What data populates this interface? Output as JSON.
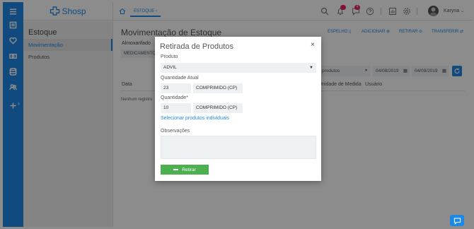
{
  "brand": {
    "name": "Shosp"
  },
  "sidebar": {
    "title": "Estoque",
    "items": [
      {
        "label": "Movimentação",
        "active": true
      },
      {
        "label": "Produtos",
        "active": false
      }
    ]
  },
  "rail": {
    "icons": [
      "menu-icon",
      "list-icon",
      "heart-icon",
      "money-icon",
      "database-icon",
      "people-icon",
      "plus-icon"
    ],
    "expand_glyph": "›"
  },
  "topbar": {
    "breadcrumb": "ESTOQUE",
    "notification_badge": "",
    "messages_badge": "4",
    "user_name": "Karyna",
    "user_caret": "⌄"
  },
  "page": {
    "title": "Movimentação de Estoque",
    "actions": {
      "espelho": "ESPELHO",
      "adicionar": "ADICIONAR",
      "retirar": "RETIRAR",
      "transferir": "TRANSFERIR"
    },
    "almoxarifado_label": "Almoxarifado",
    "almoxarifado_chip": "MEDICAMENTOS",
    "filter_select": "produtos",
    "date_from": "04/08/2019",
    "date_to": "04/09/2019",
    "columns": [
      "Data",
      "Unidade de Medida",
      "Usuário"
    ],
    "empty_text": "Nenhum registro"
  },
  "modal": {
    "title": "Retirada de Produtos",
    "close": "×",
    "produto_label": "Produto",
    "produto_value": "ADVIL",
    "produto_caret": "▼",
    "quantidade_atual_label": "Quantidade Atual",
    "quantidade_atual_value": "23",
    "quantidade_atual_unit": "COMPRIMIDO (CP)",
    "quantidade_label": "Quantidade*",
    "quantidade_value": "10",
    "quantidade_unit": "COMPRIMIDO (CP)",
    "individual_link": "Selecionar produtos individuais",
    "observacoes_label": "Observações",
    "observacoes_value": "",
    "submit_label": "Retirar"
  },
  "colors": {
    "primary": "#1e88e5",
    "success": "#4caf50",
    "badge": "#e91e63"
  }
}
